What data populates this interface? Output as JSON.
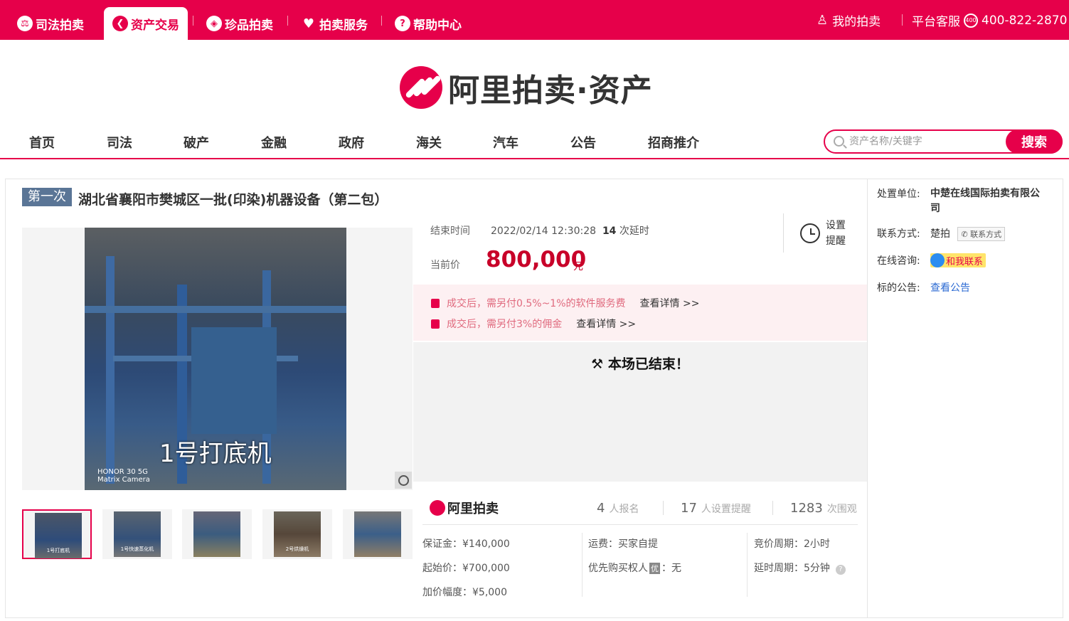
{
  "topbar": {
    "items": [
      {
        "label": "司法拍卖",
        "icon": "court-icon"
      },
      {
        "label": "资产交易",
        "icon": "asset-icon",
        "active": true
      },
      {
        "label": "珍品拍卖",
        "icon": "treasure-icon"
      },
      {
        "label": "拍卖服务",
        "icon": "heart-icon"
      },
      {
        "label": "帮助中心",
        "icon": "question-icon"
      }
    ],
    "my_auction": "我的拍卖",
    "service_label": "平台客服",
    "service_phone": "400-822-2870",
    "accent_color": "#e6004a"
  },
  "logo": {
    "text": "阿里拍卖·资产"
  },
  "nav": {
    "items": [
      "首页",
      "司法",
      "破产",
      "金融",
      "政府",
      "海关",
      "汽车",
      "公告",
      "招商推介"
    ]
  },
  "search": {
    "placeholder": "资产名称/关键字",
    "button": "搜索"
  },
  "item": {
    "badge": "第一次",
    "title": "湖北省襄阳市樊城区一批(印染)机器设备（第二包）",
    "image_caption": "1号打底机",
    "image_watermark_line1": "HONOR 30 5G",
    "image_watermark_line2": "Matrix Camera",
    "thumbs": [
      "1号打底机",
      "1号快速蒸化机",
      "",
      "2号烘燥机",
      ""
    ]
  },
  "auction": {
    "end_label": "结束时间",
    "end_time": "2022/02/14 12:30:28",
    "delay_count": "14",
    "delay_suffix": "次延时",
    "price_label": "当前价",
    "price": "800,000",
    "price_unit": "元",
    "remind_line1": "设置",
    "remind_line2": "提醒",
    "notices": [
      {
        "text": "成交后，需另付0.5%~1%的软件服务费",
        "link": "查看详情 >>"
      },
      {
        "text": "成交后，需另付3%的佣金",
        "link": "查看详情 >>"
      }
    ],
    "ended_text": "本场已结束！"
  },
  "stats": {
    "brand": "阿里拍卖",
    "signups": "4",
    "signups_label": "人报名",
    "reminders": "17",
    "reminders_label": "人设置提醒",
    "views": "1283",
    "views_label": "次围观"
  },
  "details": {
    "deposit": "保证金：¥140,000",
    "start_price": "起始价：¥700,000",
    "increment": "加价幅度：¥5,000",
    "shipping": "运费：买家自提",
    "priority_label": "优先购买权人",
    "priority_tag": "优",
    "priority_value": "：无",
    "bid_period": "竞价周期：2小时",
    "delay_period": "延时周期：5分钟"
  },
  "sidebar": {
    "unit_label": "处置单位:",
    "unit_value_line1": "中楚在线国际拍卖有限公",
    "unit_value_line2": "司",
    "contact_label": "联系方式:",
    "contact_value": "楚拍",
    "contact_button": "联系方式",
    "consult_label": "在线咨询:",
    "consult_button": "和我联系",
    "notice_label": "标的公告:",
    "notice_link": "查看公告"
  }
}
